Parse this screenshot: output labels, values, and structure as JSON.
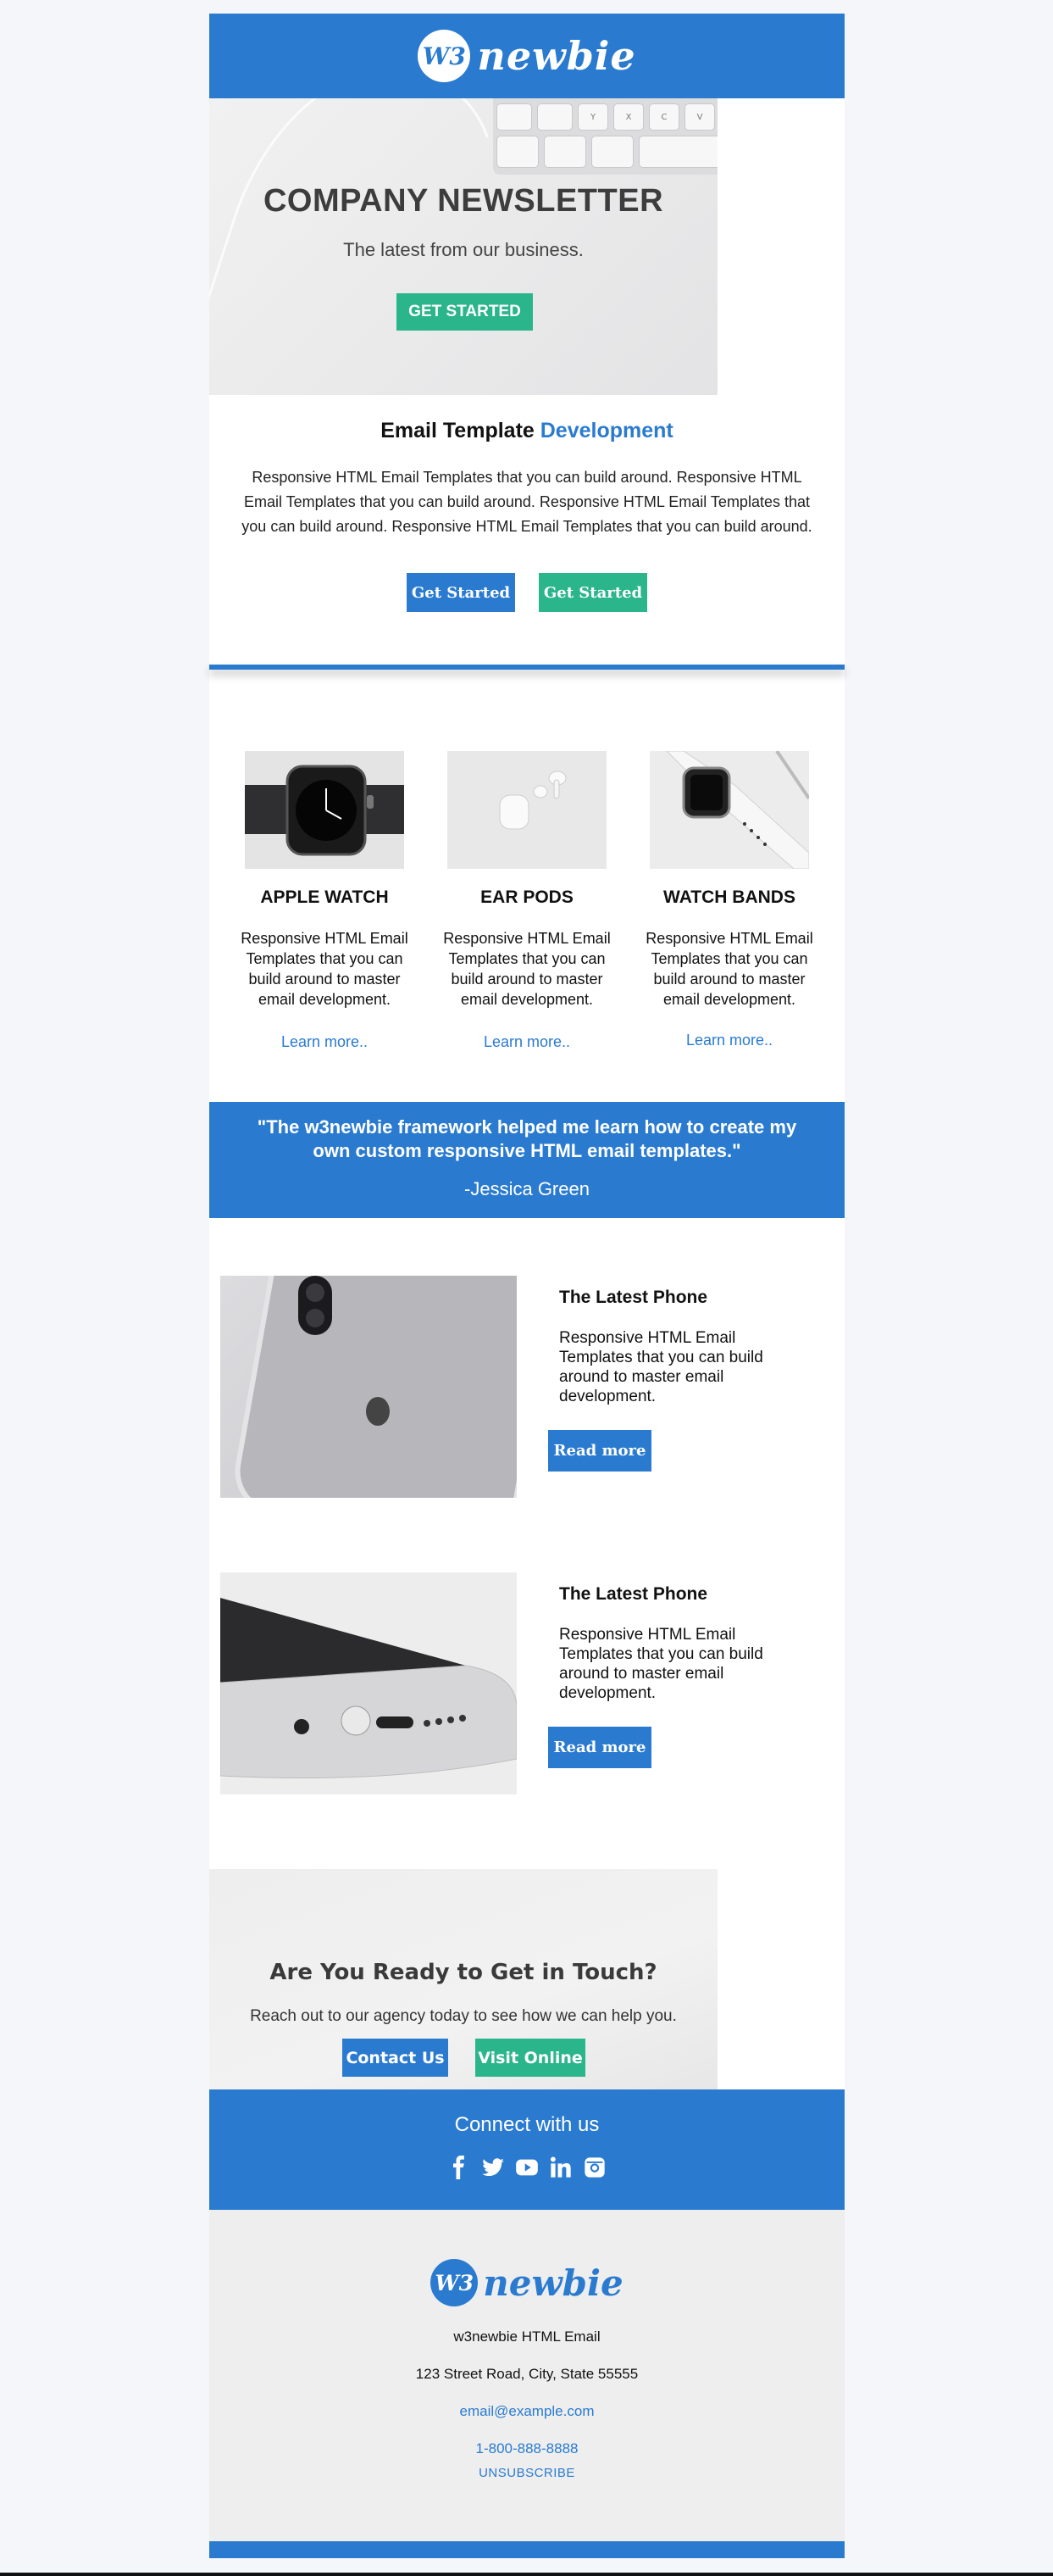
{
  "brand": {
    "badge": "W3",
    "word": "newbie"
  },
  "hero": {
    "title": "COMPANY NEWSLETTER",
    "subtitle": "The latest from our business.",
    "cta": "GET STARTED",
    "keys": [
      "",
      "",
      "Y",
      "X",
      "C",
      "V"
    ]
  },
  "intro": {
    "title_plain": "Email Template ",
    "title_highlight": "Development",
    "body": "Responsive HTML Email Templates that you can build around. Responsive HTML Email Templates that you can build around. Responsive HTML Email Templates that you can build around. Responsive HTML Email Templates that you can build around.",
    "btn_primary": "Get Started",
    "btn_secondary": "Get Started"
  },
  "products": [
    {
      "title": "APPLE WATCH",
      "body": "Responsive HTML Email Templates that you can build around to master email development.",
      "link": "Learn more.."
    },
    {
      "title": "EAR PODS",
      "body": "Responsive HTML Email Templates that you can build around to master email development.",
      "link": "Learn more.."
    },
    {
      "title": "WATCH BANDS",
      "body": "Responsive HTML Email Templates that you can build around to master email development.",
      "link": "Learn more.."
    }
  ],
  "quote": {
    "text": "\"The w3newbie framework helped me learn how to create my own custom responsive HTML email templates.\"",
    "author": "-Jessica Green"
  },
  "articles": [
    {
      "title": "The Latest Phone",
      "body": "Responsive HTML Email Templates that you can build around to master email development.",
      "button": "Read more"
    },
    {
      "title": "The Latest Phone",
      "body": "Responsive HTML Email Templates that you can build around to master email development.",
      "button": "Read more"
    }
  ],
  "contact": {
    "title": "Are You Ready to Get in Touch?",
    "body": "Reach out to our agency today to see how we can help you.",
    "btn_contact": "Contact Us",
    "btn_visit": "Visit Online"
  },
  "social": {
    "title": "Connect with us",
    "icons": [
      "facebook-icon",
      "twitter-icon",
      "youtube-icon",
      "linkedin-icon",
      "instagram-icon"
    ]
  },
  "footer": {
    "company": "w3newbie HTML Email",
    "address": "123 Street Road, City, State 55555",
    "email": "email@example.com",
    "phone": "1-800-888-8888",
    "unsubscribe": "UNSUBSCRIBE"
  },
  "colors": {
    "primary": "#2a7bd0",
    "accent": "#2bb58a",
    "page_bg": "#f4f6fa",
    "footer_bg": "#eeeeee"
  }
}
